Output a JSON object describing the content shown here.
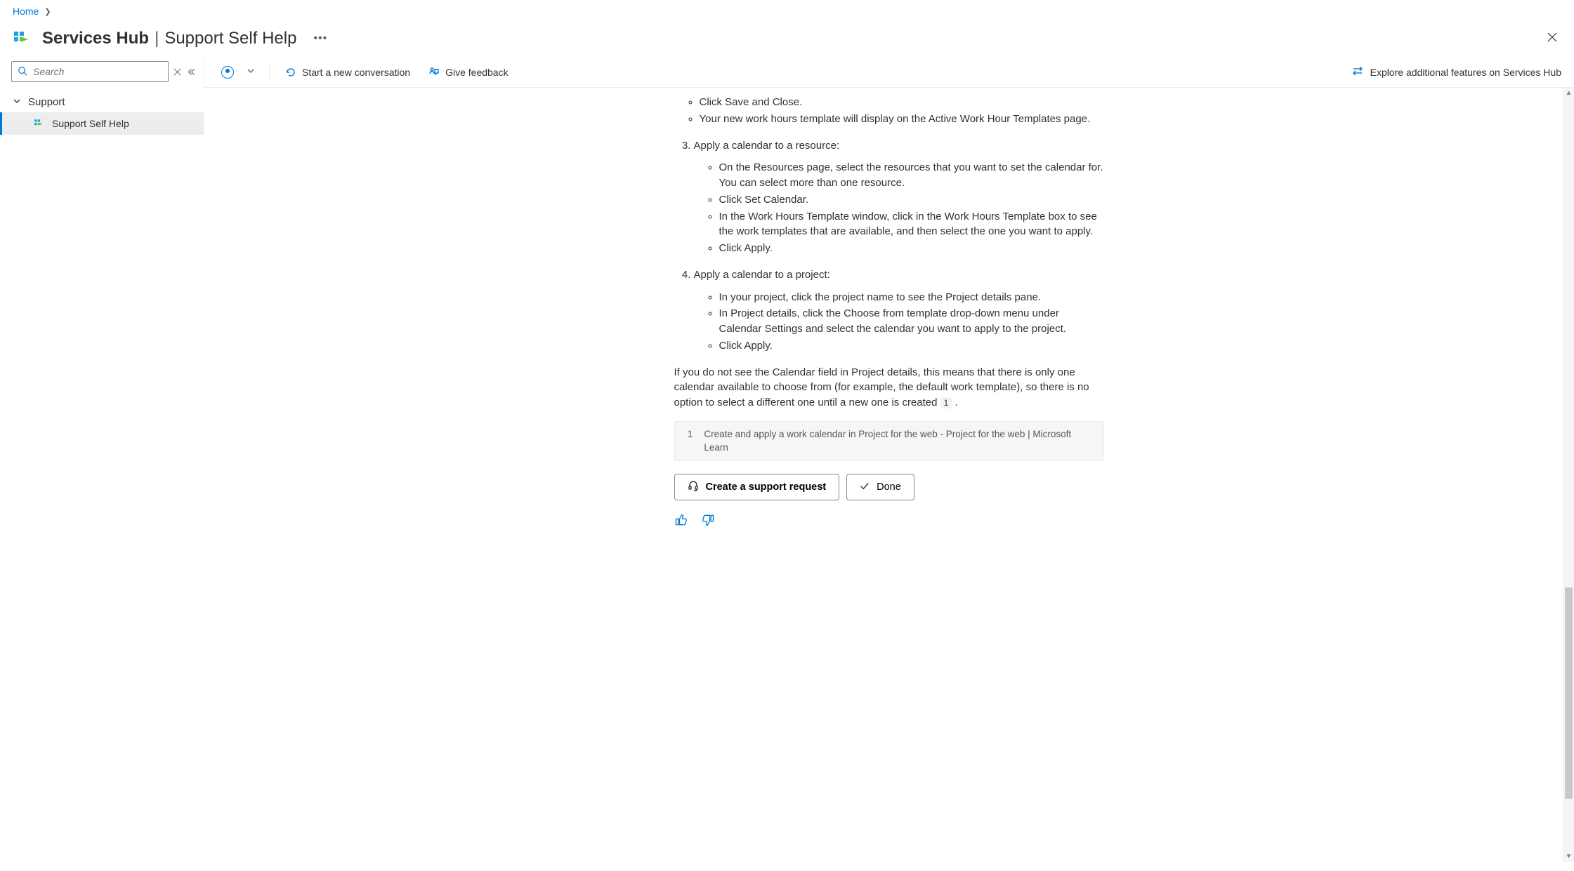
{
  "breadcrumb": {
    "home_label": "Home"
  },
  "title": {
    "app_name": "Services Hub",
    "separator": "|",
    "page_name": "Support Self Help"
  },
  "sidebar": {
    "search_placeholder": "Search",
    "group_label": "Support",
    "items": [
      {
        "label": "Support Self Help"
      }
    ]
  },
  "toolbar": {
    "start_conversation_label": "Start a new conversation",
    "give_feedback_label": "Give feedback",
    "explore_label": "Explore additional features on Services Hub"
  },
  "content": {
    "step2_sub": [
      "Click Save and Close.",
      "Your new work hours template will display on the Active Work Hour Templates page."
    ],
    "step3_title": "Apply a calendar to a resource:",
    "step3_sub": [
      "On the Resources page, select the resources that you want to set the calendar for. You can select more than one resource.",
      "Click Set Calendar.",
      "In the Work Hours Template window, click in the Work Hours Template box to see the work templates that are available, and then select the one you want to apply.",
      "Click Apply."
    ],
    "step4_title": "Apply a calendar to a project:",
    "step4_sub": [
      "In your project, click the project name to see the Project details pane.",
      "In Project details, click the Choose from template drop-down menu under Calendar Settings and select the calendar you want to apply to the project.",
      "Click Apply."
    ],
    "closing_para": "If you do not see the Calendar field in Project details, this means that there is only one calendar available to choose from (for example, the default work template), so there is no option to select a different one until a new one is created ",
    "closing_after_ref": " .",
    "ref_label": "1",
    "citation_num": "1",
    "citation_text": "Create and apply a work calendar in Project for the web - Project for the web | Microsoft Learn",
    "create_request_label": "Create a support request",
    "done_label": "Done"
  }
}
